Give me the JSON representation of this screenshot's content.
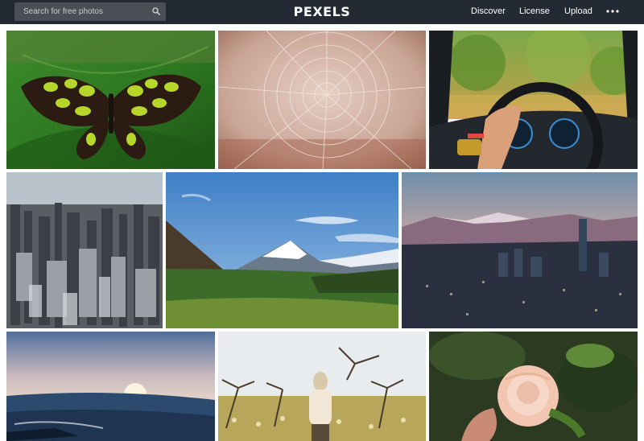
{
  "header": {
    "search_placeholder": "Search for free photos",
    "logo": "PEXELS",
    "nav": [
      "Discover",
      "License",
      "Upload"
    ],
    "more_icon": "ellipsis-icon",
    "search_icon": "magnifier-icon"
  },
  "photos": [
    {
      "subject": "butterfly"
    },
    {
      "subject": "spider-web"
    },
    {
      "subject": "car-steering-wheel"
    },
    {
      "subject": "city-skyline"
    },
    {
      "subject": "snowy-mountains"
    },
    {
      "subject": "city-at-dusk-mountains"
    },
    {
      "subject": "ocean-sunset"
    },
    {
      "subject": "woman-in-vineyard"
    },
    {
      "subject": "peach-rose"
    }
  ],
  "colors": {
    "header_bg": "#232a34",
    "search_bg": "#4a4f57"
  }
}
